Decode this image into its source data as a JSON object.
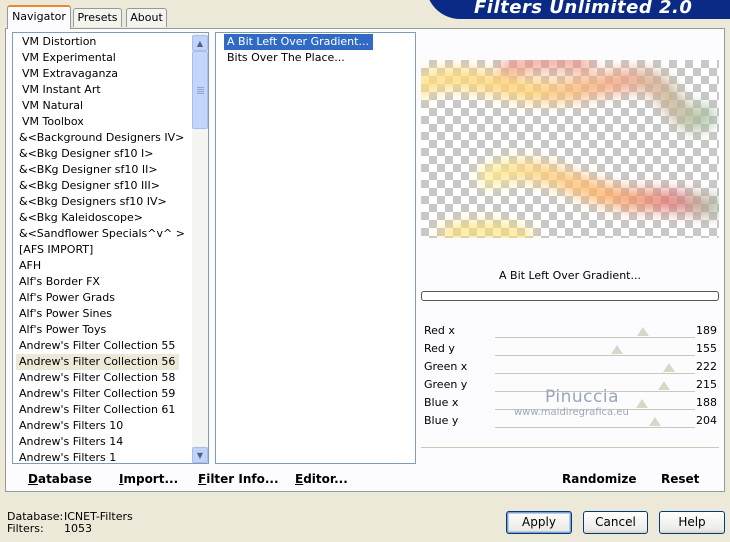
{
  "tabs": [
    {
      "label": "Navigator",
      "active": true
    },
    {
      "label": "Presets",
      "active": false
    },
    {
      "label": "About",
      "active": false
    }
  ],
  "banner": {
    "title": "Filters Unlimited 2.0"
  },
  "categories": [
    "VM Distortion",
    "VM Experimental",
    "VM Extravaganza",
    "VM Instant Art",
    "VM Natural",
    "VM Toolbox",
    "&<Background Designers IV>",
    "&<Bkg Designer sf10 I>",
    "&<BKg Designer sf10 II>",
    "&<Bkg Designer sf10 III>",
    "&<Bkg Designers sf10 IV>",
    "&<Bkg Kaleidoscope>",
    "&<Sandflower Specials^v^ >",
    "[AFS IMPORT]",
    "AFH",
    "Alf's Border FX",
    "Alf's Power Grads",
    "Alf's Power Sines",
    "Alf's Power Toys",
    "Andrew's Filter Collection 55",
    "Andrew's Filter Collection 56",
    "Andrew's Filter Collection 58",
    "Andrew's Filter Collection 59",
    "Andrew's Filter Collection 61",
    "Andrew's Filters 10",
    "Andrew's Filters 14",
    "Andrew's Filters 1"
  ],
  "selected_category_index": 20,
  "filters": [
    "A Bit Left Over Gradient...",
    "Bits Over The Place..."
  ],
  "selected_filter_index": 0,
  "left_buttons": {
    "database": "Database",
    "import": "Import...",
    "filter_info": "Filter Info...",
    "editor": "Editor..."
  },
  "preview": {
    "filter_name": "A Bit Left Over Gradient..."
  },
  "sliders": [
    {
      "label": "Red x",
      "value": "189"
    },
    {
      "label": "Red y",
      "value": "155"
    },
    {
      "label": "Green x",
      "value": "222"
    },
    {
      "label": "Green y",
      "value": "215"
    },
    {
      "label": "Blue x",
      "value": "188"
    },
    {
      "label": "Blue y",
      "value": "204"
    }
  ],
  "right_buttons": {
    "randomize": "Randomize",
    "reset": "Reset"
  },
  "watermark": {
    "line1": "Pinuccia",
    "line2": "www.maidiregrafica.eu"
  },
  "status": {
    "database_label": "Database:",
    "database_value": "ICNET-Filters",
    "filters_label": "Filters:",
    "filters_value": "1053"
  },
  "dialog_buttons": {
    "apply": "Apply",
    "cancel": "Cancel",
    "help": "Help"
  }
}
